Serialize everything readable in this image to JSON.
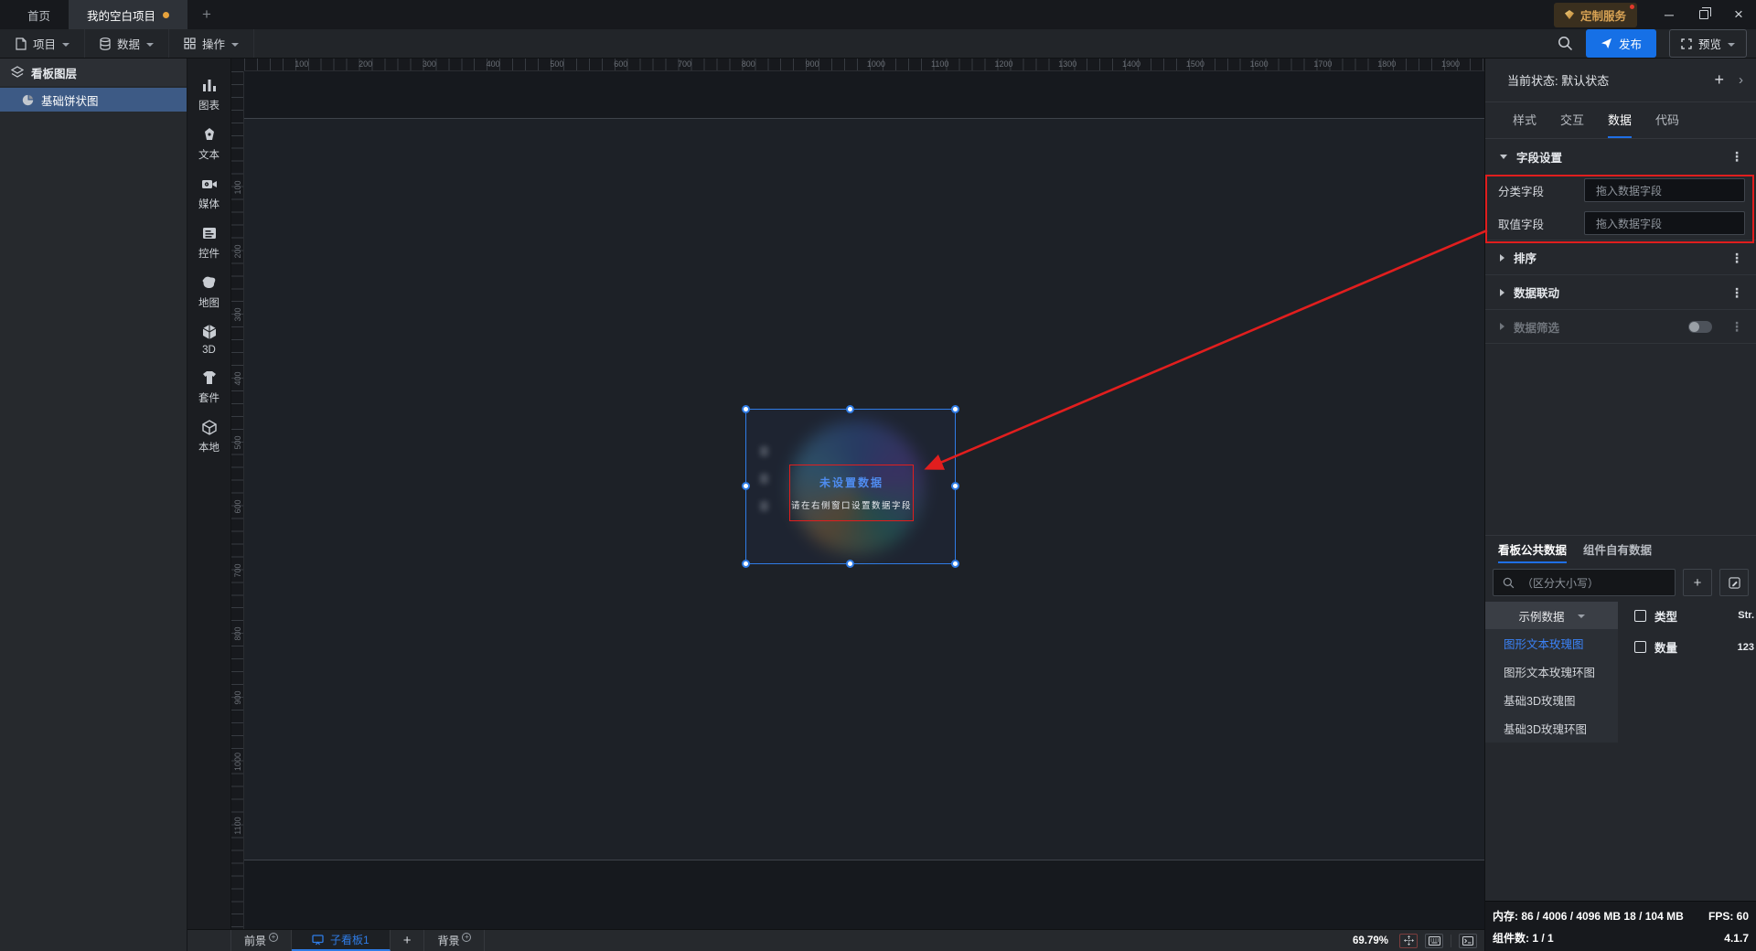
{
  "colors": {
    "accent_blue": "#1f6fe5",
    "publish_blue": "#1670e6",
    "annotation_red": "#e11e1e",
    "selected_layer_blue": "#3d5a85",
    "badge_gold": "#d7a254",
    "modified_dot_orange": "#e6a23c"
  },
  "title_bar": {
    "tabs": [
      {
        "label": "首页"
      },
      {
        "label": "我的空白项目"
      }
    ],
    "new_tab": "+",
    "badge": "定制服务",
    "minimize": "─",
    "close": "×"
  },
  "menu_bar": {
    "project": "项目",
    "data": "数据",
    "action": "操作",
    "publish": "发布",
    "preview": "预览"
  },
  "sidebar": {
    "header": "看板图层",
    "layer_item": "基础饼状图"
  },
  "toolstrip": {
    "items": [
      {
        "label": "图表"
      },
      {
        "label": "文本"
      },
      {
        "label": "媒体"
      },
      {
        "label": "控件"
      },
      {
        "label": "地图"
      },
      {
        "label": "3D"
      },
      {
        "label": "套件"
      },
      {
        "label": "本地"
      }
    ]
  },
  "rulers": {
    "horizontal": [
      "100",
      "200",
      "300",
      "400",
      "500",
      "600",
      "700",
      "800",
      "900",
      "1000",
      "1100",
      "1200",
      "1300",
      "1400",
      "1500",
      "1600",
      "1700",
      "1800",
      "1900"
    ],
    "vertical": [
      "100",
      "200",
      "300",
      "400",
      "500",
      "600",
      "700",
      "800",
      "900",
      "1000",
      "1100"
    ]
  },
  "canvas": {
    "widget_title": "未设置数据",
    "widget_subtitle": "请在右侧窗口设置数据字段"
  },
  "right_panel": {
    "state_text": "当前状态: 默认状态",
    "add": "+",
    "arrow": "›",
    "tabs": [
      "样式",
      "交互",
      "数据",
      "代码"
    ],
    "active_tab": "数据",
    "field_section": "字段设置",
    "fields": [
      {
        "label": "分类字段",
        "placeholder": "拖入数据字段"
      },
      {
        "label": "取值字段",
        "placeholder": "拖入数据字段"
      }
    ],
    "sort_section": "排序",
    "linkage_section": "数据联动",
    "filter_section": "数据筛选",
    "kebab": "⋮"
  },
  "data_panel": {
    "tabs": [
      "看板公共数据",
      "组件自有数据"
    ],
    "active_tab": "看板公共数据",
    "search_placeholder": "（区分大小写）",
    "add": "+",
    "dataset_selector": "示例数据",
    "datasets": [
      "图形文本玫瑰图",
      "图形文本玫瑰环图",
      "基础3D玫瑰图",
      "基础3D玫瑰环图"
    ],
    "selected_dataset": "图形文本玫瑰图",
    "fields": [
      {
        "name": "类型",
        "type": "Str."
      },
      {
        "name": "数量",
        "type": "123"
      }
    ]
  },
  "bottom_bar": {
    "foreground": "前景",
    "board_tab": "子看板1",
    "add_board": "+",
    "background": "背景",
    "zoom": "69.79%"
  },
  "status_bar": {
    "memory_text": "内存: 86 / 4006 / 4096 MB  18 / 104 MB",
    "fps_text": "FPS: 60",
    "components_text": "组件数: 1 / 1",
    "version": "4.1.7"
  }
}
